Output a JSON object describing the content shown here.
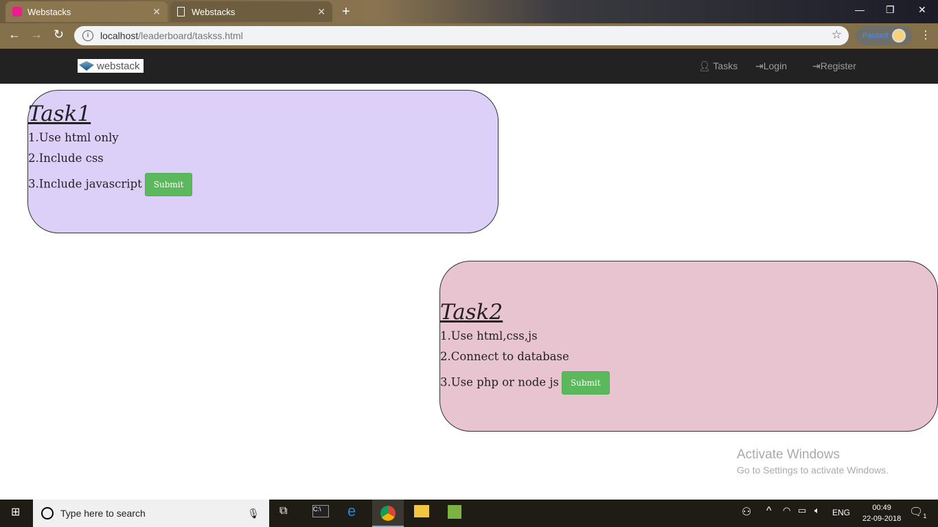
{
  "browser": {
    "tabs": [
      {
        "title": "Webstacks",
        "active": true
      },
      {
        "title": "Webstacks",
        "active": false
      }
    ],
    "url_host": "localhost",
    "url_path": "/leaderboard/taskss.html",
    "profile_status": "Paused"
  },
  "navbar": {
    "logo_text": "webstack",
    "links": [
      {
        "label": "Tasks",
        "icon": "user-icon"
      },
      {
        "label": "Login",
        "icon": "login-icon"
      },
      {
        "label": "Register",
        "icon": "login-icon"
      }
    ]
  },
  "tasks": [
    {
      "title": "Task1",
      "items": [
        "1.Use html only",
        "2.Include css",
        "3.Include javascript"
      ],
      "submit": "Submit",
      "color": "#dcd0f8"
    },
    {
      "title": "Task2",
      "items": [
        "1.Use html,css,js",
        "2.Connect to database",
        "3.Use php or node js"
      ],
      "submit": "Submit",
      "color": "#e8c3d0"
    }
  ],
  "watermark": {
    "title": "Activate Windows",
    "subtitle": "Go to Settings to activate Windows."
  },
  "taskbar": {
    "search_placeholder": "Type here to search",
    "language": "ENG",
    "time": "00:49",
    "date": "22-09-2018",
    "notifications": "1"
  }
}
